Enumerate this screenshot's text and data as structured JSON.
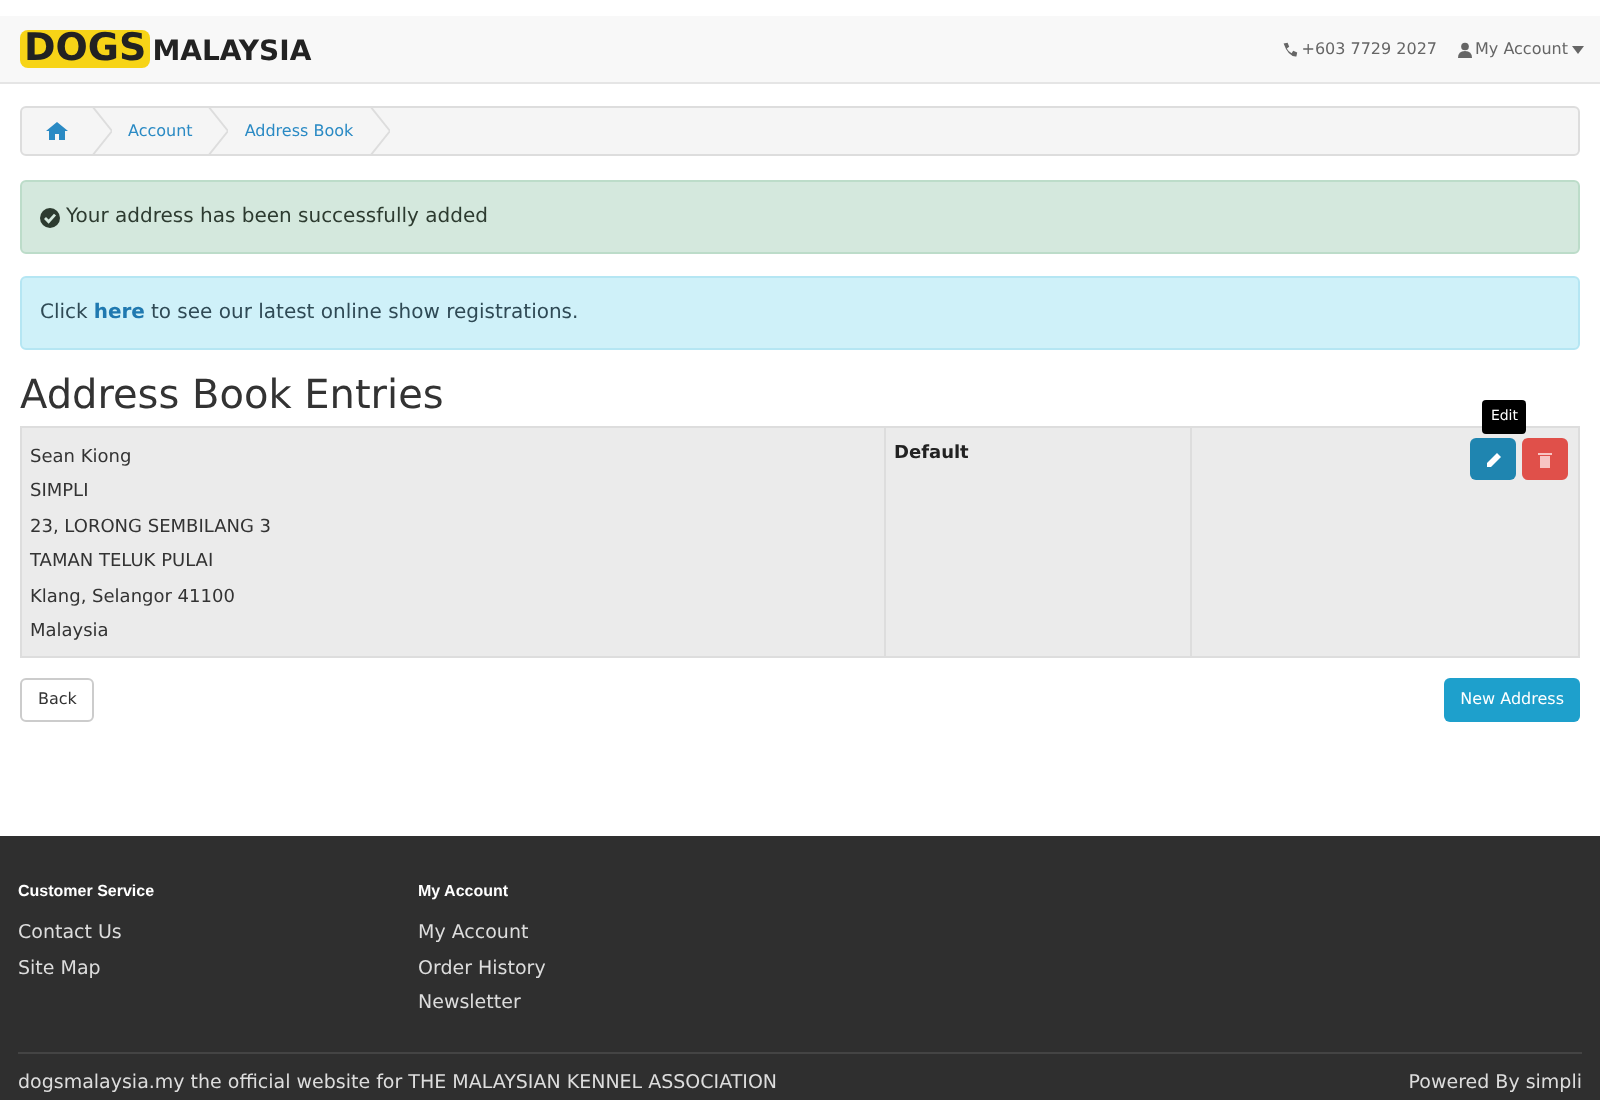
{
  "header": {
    "logo": {
      "part_1": "DOGS",
      "part_2": "MALAYSIA"
    },
    "phone": "+603 7729 2027",
    "account_menu": "My Account"
  },
  "breadcrumb": [
    "Account",
    "Address Book"
  ],
  "success_alert": "Your address has been successfully added",
  "info_alert": {
    "before": "Click",
    "link": "here",
    "after": "to see our latest online show registrations."
  },
  "heading": "Address Book Entries",
  "entries": [
    {
      "lines": [
        "Sean Kiong",
        "SIMPLI",
        "23, LORONG SEMBILANG 3",
        "TAMAN TELUK PULAI",
        "Klang, Selangor 41100",
        "Malaysia"
      ],
      "status": "Default",
      "tooltip": "Edit"
    }
  ],
  "buttons": {
    "back": "Back",
    "new": "New Address"
  },
  "footer": {
    "columns": [
      {
        "title": "Customer Service",
        "links": [
          "Contact Us",
          "Site Map"
        ]
      },
      {
        "title": "My Account",
        "links": [
          "My Account",
          "Order History",
          "Newsletter"
        ]
      }
    ],
    "copyright": "dogsmalaysia.my the official website for THE MALAYSIAN KENNEL ASSOCIATION",
    "powered": "Powered By simpli"
  }
}
